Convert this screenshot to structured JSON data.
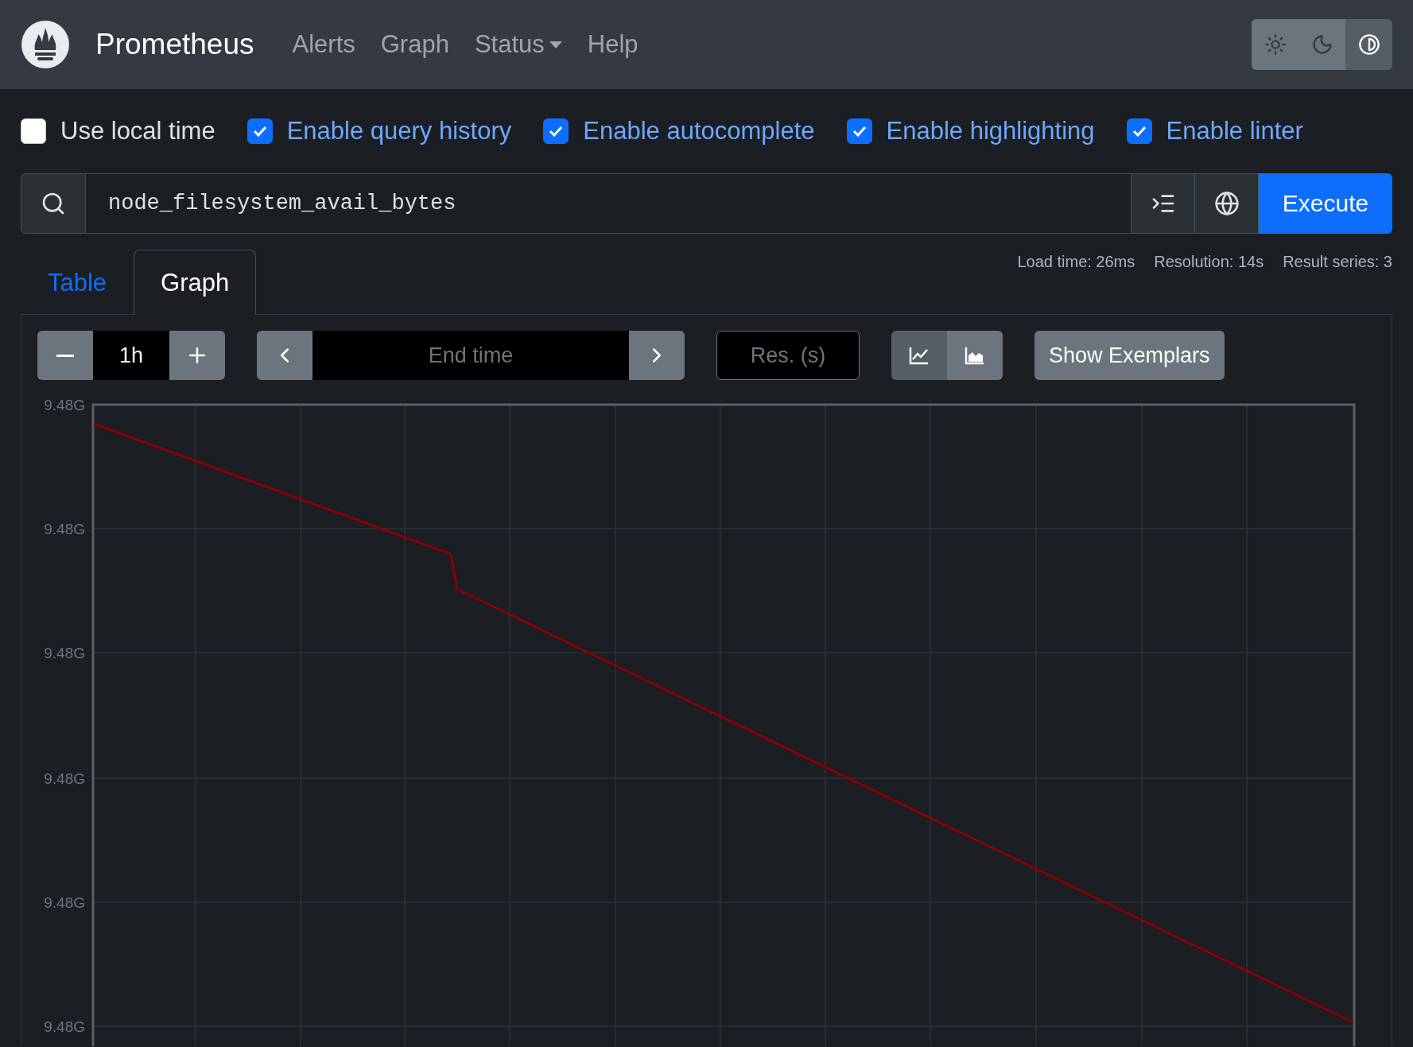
{
  "navbar": {
    "brand": "Prometheus",
    "links": [
      {
        "label": "Alerts",
        "kind": "link"
      },
      {
        "label": "Graph",
        "kind": "link"
      },
      {
        "label": "Status",
        "kind": "dropdown"
      },
      {
        "label": "Help",
        "kind": "link"
      }
    ],
    "theme_buttons": [
      {
        "kind": "light",
        "selected": false
      },
      {
        "kind": "dark",
        "selected": false
      },
      {
        "kind": "auto",
        "selected": true
      }
    ]
  },
  "options": [
    {
      "label": "Use local time",
      "checked": false
    },
    {
      "label": "Enable query history",
      "checked": true
    },
    {
      "label": "Enable autocomplete",
      "checked": true
    },
    {
      "label": "Enable highlighting",
      "checked": true
    },
    {
      "label": "Enable linter",
      "checked": true
    }
  ],
  "query": {
    "value": "node_filesystem_avail_bytes",
    "execute_label": "Execute"
  },
  "tabs": [
    {
      "label": "Table",
      "selected": false
    },
    {
      "label": "Graph",
      "selected": true
    }
  ],
  "stats": [
    "Load time: 26ms",
    "Resolution: 14s",
    "Result series: 3"
  ],
  "controls": {
    "range": "1h",
    "end_time_placeholder": "End time",
    "resolution_placeholder": "Res. (s)",
    "chart_types": [
      {
        "kind": "line",
        "selected": true
      },
      {
        "kind": "stacked",
        "selected": false
      }
    ],
    "exemplars_label": "Show Exemplars"
  },
  "chart": {
    "y_tick_labels": [
      "9.48G",
      "9.48G",
      "9.48G",
      "9.48G",
      "9.48G",
      "9.48G"
    ]
  }
}
